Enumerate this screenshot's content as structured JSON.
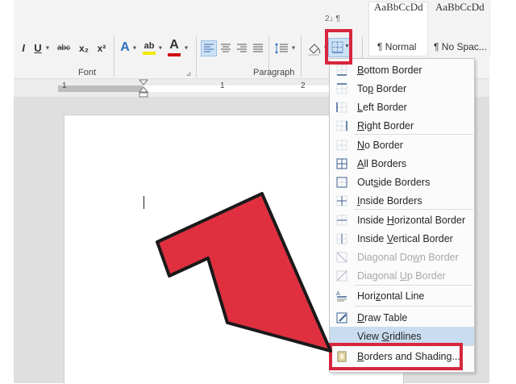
{
  "ribbon": {
    "font_group_label": "Font",
    "paragraph_group_label": "Paragraph",
    "italic": "I",
    "underline": "U",
    "strike": "abc",
    "subscript": "x₂",
    "superscript": "x²",
    "text_effects": "A",
    "highlight": "ab",
    "font_color": "A",
    "styles": [
      {
        "preview": "AaBbCcDd",
        "name": "¶ Normal"
      },
      {
        "preview": "AaBbCcDd",
        "name": "¶ No Spac..."
      }
    ],
    "highlight_color": "#f5e800",
    "font_color_bar": "#d10e0e"
  },
  "ruler": {
    "marks": [
      "1",
      "1",
      "2"
    ]
  },
  "borders_menu": {
    "items": [
      {
        "pre": "",
        "u": "B",
        "post": "ottom Border",
        "icon": "border-bottom-icon",
        "state": "normal"
      },
      {
        "pre": "To",
        "u": "p",
        "post": " Border",
        "icon": "border-top-icon",
        "state": "normal"
      },
      {
        "pre": "",
        "u": "L",
        "post": "eft Border",
        "icon": "border-left-icon",
        "state": "normal"
      },
      {
        "pre": "",
        "u": "R",
        "post": "ight Border",
        "icon": "border-right-icon",
        "state": "normal"
      },
      {
        "pre": "",
        "u": "N",
        "post": "o Border",
        "icon": "border-none-icon",
        "state": "normal"
      },
      {
        "pre": "",
        "u": "A",
        "post": "ll Borders",
        "icon": "border-all-icon",
        "state": "normal"
      },
      {
        "pre": "Out",
        "u": "s",
        "post": "ide Borders",
        "icon": "border-outside-icon",
        "state": "normal"
      },
      {
        "pre": "",
        "u": "I",
        "post": "nside Borders",
        "icon": "border-inside-icon",
        "state": "normal"
      },
      {
        "pre": "Inside ",
        "u": "H",
        "post": "orizontal Border",
        "icon": "border-inside-horizontal-icon",
        "state": "normal"
      },
      {
        "pre": "Inside ",
        "u": "V",
        "post": "ertical Border",
        "icon": "border-inside-vertical-icon",
        "state": "normal"
      },
      {
        "pre": "Diagonal Do",
        "u": "w",
        "post": "n Border",
        "icon": "border-diagonal-down-icon",
        "state": "disabled"
      },
      {
        "pre": "Diagonal ",
        "u": "U",
        "post": "p Border",
        "icon": "border-diagonal-up-icon",
        "state": "disabled"
      },
      {
        "pre": "Hori",
        "u": "z",
        "post": "ontal Line",
        "icon": "horizontal-line-icon",
        "state": "normal"
      },
      {
        "pre": "",
        "u": "D",
        "post": "raw Table",
        "icon": "draw-table-icon",
        "state": "normal"
      },
      {
        "pre": "View ",
        "u": "G",
        "post": "ridlines",
        "icon": "view-gridlines-icon",
        "state": "highlighted"
      },
      {
        "pre": "",
        "u": "B",
        "post": "orders and Shading...",
        "icon": "borders-shading-icon",
        "state": "normal"
      }
    ]
  },
  "annotation": {
    "arrow_color": "#e03040",
    "box_color": "#d7263d"
  }
}
